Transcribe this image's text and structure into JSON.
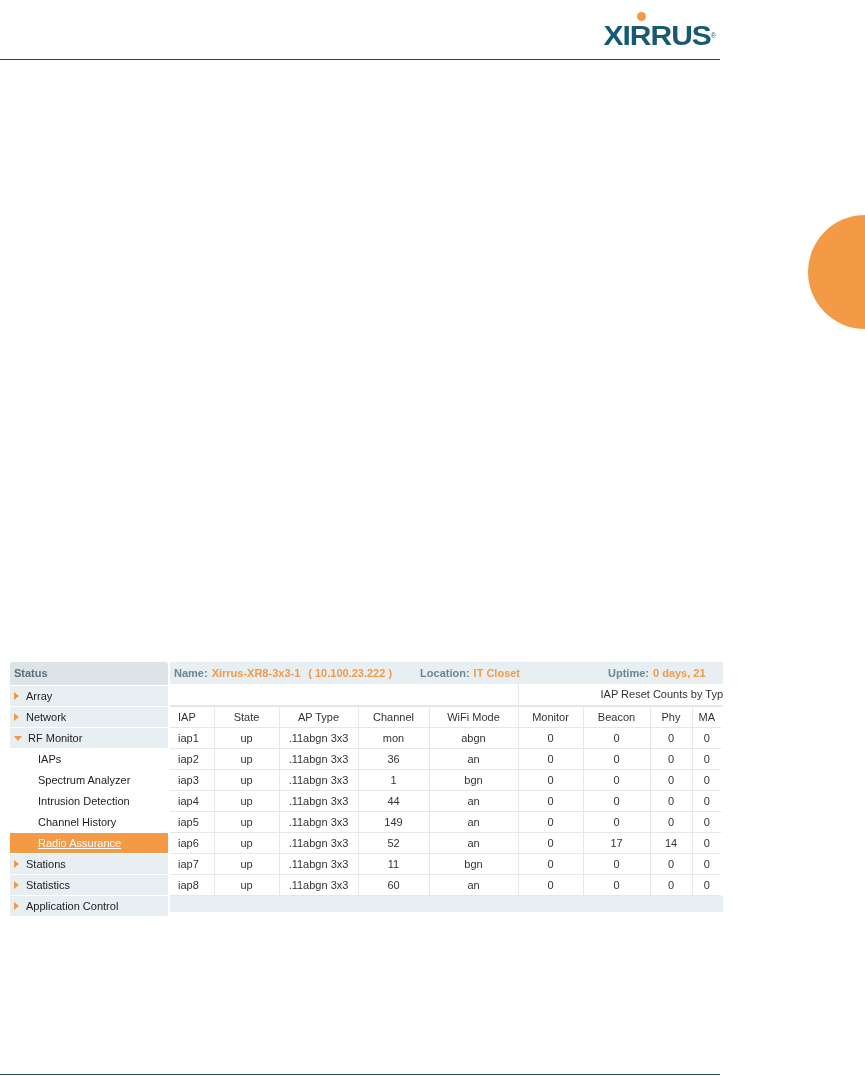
{
  "logo": {
    "text": "XIRRUS",
    "mark": "®"
  },
  "sidebar": {
    "title": "Status",
    "items": [
      {
        "label": "Array",
        "expanded": false,
        "selected": false
      },
      {
        "label": "Network",
        "expanded": false,
        "selected": false
      },
      {
        "label": "RF Monitor",
        "expanded": true,
        "selected": false,
        "children": [
          {
            "label": "IAPs",
            "selected": false
          },
          {
            "label": "Spectrum Analyzer",
            "selected": false
          },
          {
            "label": "Intrusion Detection",
            "selected": false
          },
          {
            "label": "Channel History",
            "selected": false
          },
          {
            "label": "Radio Assurance",
            "selected": true
          }
        ]
      },
      {
        "label": "Stations",
        "expanded": false,
        "selected": false
      },
      {
        "label": "Statistics",
        "expanded": false,
        "selected": false
      },
      {
        "label": "Application Control",
        "expanded": false,
        "selected": false
      }
    ]
  },
  "info_bar": {
    "name_label": "Name:",
    "name": "Xirrus-XR8-3x3-1",
    "address": "( 10.100.23.222 )",
    "location_label": "Location:",
    "location": "IT Closet",
    "uptime_label": "Uptime:",
    "uptime": "0 days, 21"
  },
  "table": {
    "group_header": "IAP Reset Counts by Typ",
    "columns": [
      "IAP",
      "State",
      "AP Type",
      "Channel",
      "WiFi Mode",
      "Monitor",
      "Beacon",
      "Phy",
      "MA"
    ],
    "rows": [
      [
        "iap1",
        "up",
        ".11abgn 3x3",
        "mon",
        "abgn",
        "0",
        "0",
        "0",
        "0"
      ],
      [
        "iap2",
        "up",
        ".11abgn 3x3",
        "36",
        "an",
        "0",
        "0",
        "0",
        "0"
      ],
      [
        "iap3",
        "up",
        ".11abgn 3x3",
        "1",
        "bgn",
        "0",
        "0",
        "0",
        "0"
      ],
      [
        "iap4",
        "up",
        ".11abgn 3x3",
        "44",
        "an",
        "0",
        "0",
        "0",
        "0"
      ],
      [
        "iap5",
        "up",
        ".11abgn 3x3",
        "149",
        "an",
        "0",
        "0",
        "0",
        "0"
      ],
      [
        "iap6",
        "up",
        ".11abgn 3x3",
        "52",
        "an",
        "0",
        "17",
        "14",
        "0"
      ],
      [
        "iap7",
        "up",
        ".11abgn 3x3",
        "11",
        "bgn",
        "0",
        "0",
        "0",
        "0"
      ],
      [
        "iap8",
        "up",
        ".11abgn 3x3",
        "60",
        "an",
        "0",
        "0",
        "0",
        "0"
      ]
    ]
  }
}
